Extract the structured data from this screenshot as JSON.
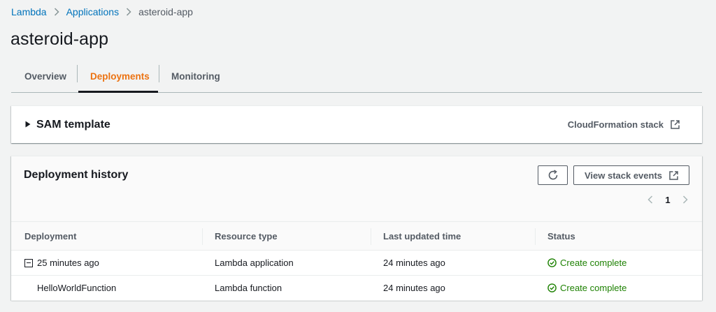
{
  "breadcrumb": [
    {
      "label": "Lambda"
    },
    {
      "label": "Applications"
    },
    {
      "label": "asteroid-app"
    }
  ],
  "page_title": "asteroid-app",
  "tabs": [
    {
      "label": "Overview"
    },
    {
      "label": "Deployments",
      "active": true
    },
    {
      "label": "Monitoring"
    }
  ],
  "sam_panel": {
    "title": "SAM template",
    "cloudformation_link": "CloudFormation stack"
  },
  "history": {
    "title": "Deployment history",
    "view_events_label": "View stack events",
    "page": "1",
    "columns": [
      "Deployment",
      "Resource type",
      "Last updated time",
      "Status"
    ],
    "rows": [
      {
        "deployment": "25 minutes ago",
        "resource_type": "Lambda application",
        "updated": "24 minutes ago",
        "status": "Create complete"
      },
      {
        "deployment": "HelloWorldFunction",
        "resource_type": "Lambda function",
        "updated": "24 minutes ago",
        "status": "Create complete"
      }
    ]
  },
  "colors": {
    "link": "#0073bb",
    "accent": "#ec7211",
    "success": "#1d8102",
    "text_secondary": "#545b64"
  },
  "icons": [
    "chevron-right-icon",
    "caret-right-icon",
    "external-link-icon",
    "refresh-icon",
    "chevron-left-icon",
    "collapse-icon",
    "check-circle-icon"
  ]
}
